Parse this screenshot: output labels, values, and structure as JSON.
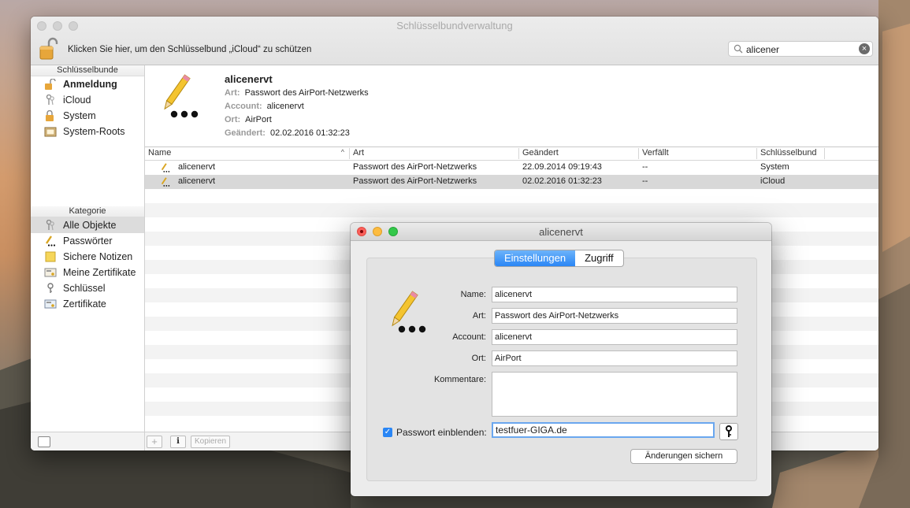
{
  "window": {
    "title": "Schlüsselbundverwaltung",
    "lock_message": "Klicken Sie hier, um den Schlüsselbund „iCloud“ zu schützen",
    "search_value": "alicener"
  },
  "sidebar": {
    "keychains_header": "Schlüsselbunde",
    "keychains": [
      {
        "label": "Anmeldung",
        "icon": "lock-open-icon"
      },
      {
        "label": "iCloud",
        "icon": "keys-icon"
      },
      {
        "label": "System",
        "icon": "lock-icon"
      },
      {
        "label": "System-Roots",
        "icon": "folder-icon"
      }
    ],
    "category_header": "Kategorie",
    "categories": [
      {
        "label": "Alle Objekte",
        "icon": "keys-icon"
      },
      {
        "label": "Passwörter",
        "icon": "pencil-dots-icon"
      },
      {
        "label": "Sichere Notizen",
        "icon": "note-icon"
      },
      {
        "label": "Meine Zertifikate",
        "icon": "certificate-icon"
      },
      {
        "label": "Schlüssel",
        "icon": "key-icon"
      },
      {
        "label": "Zertifikate",
        "icon": "certificate-icon"
      }
    ]
  },
  "detail": {
    "title": "alicenervt",
    "art_key": "Art:",
    "art_val": "Passwort des AirPort-Netzwerks",
    "account_key": "Account:",
    "account_val": "alicenervt",
    "ort_key": "Ort:",
    "ort_val": "AirPort",
    "changed_key": "Geändert:",
    "changed_val": "02.02.2016 01:32:23"
  },
  "table": {
    "columns": [
      "Name",
      "Art",
      "Geändert",
      "Verfällt",
      "Schlüsselbund"
    ],
    "rows": [
      {
        "name": "alicenervt",
        "art": "Passwort des AirPort-Netzwerks",
        "changed": "22.09.2014 09:19:43",
        "expires": "--",
        "keychain": "System"
      },
      {
        "name": "alicenervt",
        "art": "Passwort des AirPort-Netzwerks",
        "changed": "02.02.2016 01:32:23",
        "expires": "--",
        "keychain": "iCloud"
      }
    ],
    "copy_button": "Kopieren",
    "add_button": "+",
    "info_button": "i"
  },
  "dialog": {
    "title": "alicenervt",
    "tab_settings": "Einstellungen",
    "tab_access": "Zugriff",
    "name_label": "Name:",
    "name_value": "alicenervt",
    "art_label": "Art:",
    "art_value": "Passwort des AirPort-Netzwerks",
    "account_label": "Account:",
    "account_value": "alicenervt",
    "ort_label": "Ort:",
    "ort_value": "AirPort",
    "comment_label": "Kommentare:",
    "comment_value": "",
    "show_password_label": "Passwort einblenden:",
    "password_value": "testfuer-GIGA.de",
    "save_button": "Änderungen sichern"
  }
}
